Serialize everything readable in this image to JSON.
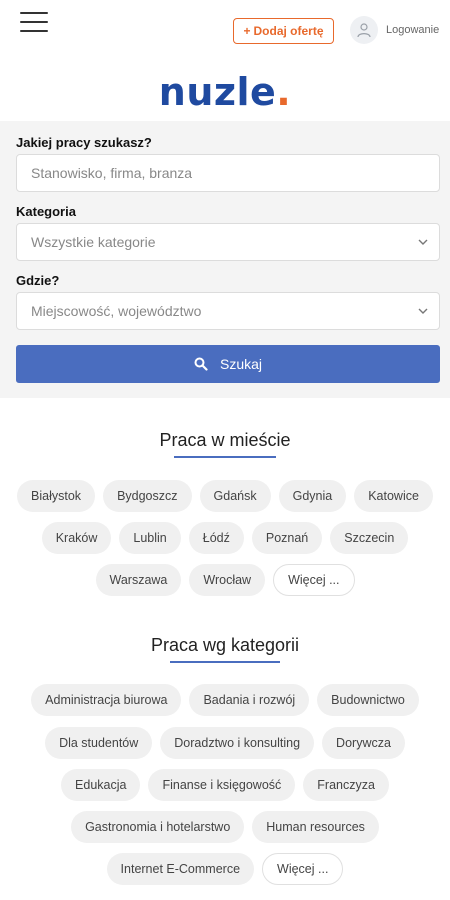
{
  "header": {
    "add_offer": "Dodaj ofertę",
    "login": "Logowanie",
    "logo_text": "nuzle",
    "logo_dot": "."
  },
  "search": {
    "job_label": "Jakiej pracy szukasz?",
    "job_placeholder": "Stanowisko, firma, branza",
    "category_label": "Kategoria",
    "category_value": "Wszystkie kategorie",
    "where_label": "Gdzie?",
    "where_value": "Miejscowość, województwo",
    "button": "Szukaj"
  },
  "cities": {
    "title": "Praca w mieście",
    "rows": [
      [
        "Białystok",
        "Bydgoszcz",
        "Gdańsk",
        "Gdynia",
        "Katowice"
      ],
      [
        "Kraków",
        "Lublin",
        "Łódź",
        "Poznań",
        "Szczecin"
      ],
      [
        "Warszawa",
        "Wrocław"
      ]
    ],
    "more": "Więcej ..."
  },
  "categories": {
    "title": "Praca wg kategorii",
    "rows": [
      [
        "Administracja biurowa",
        "Badania i rozwój",
        "Budownictwo"
      ],
      [
        "Dla studentów",
        "Doradztwo i konsulting",
        "Dorywcza"
      ],
      [
        "Edukacja",
        "Finanse i księgowość",
        "Franczyza"
      ],
      [
        "Gastronomia i hotelarstwo",
        "Human resources"
      ],
      [
        "Internet E-Commerce"
      ]
    ],
    "more": "Więcej ..."
  },
  "colors": {
    "brand": "#1f4aa0",
    "accent": "#e8692c",
    "button": "#4a6dbf"
  }
}
